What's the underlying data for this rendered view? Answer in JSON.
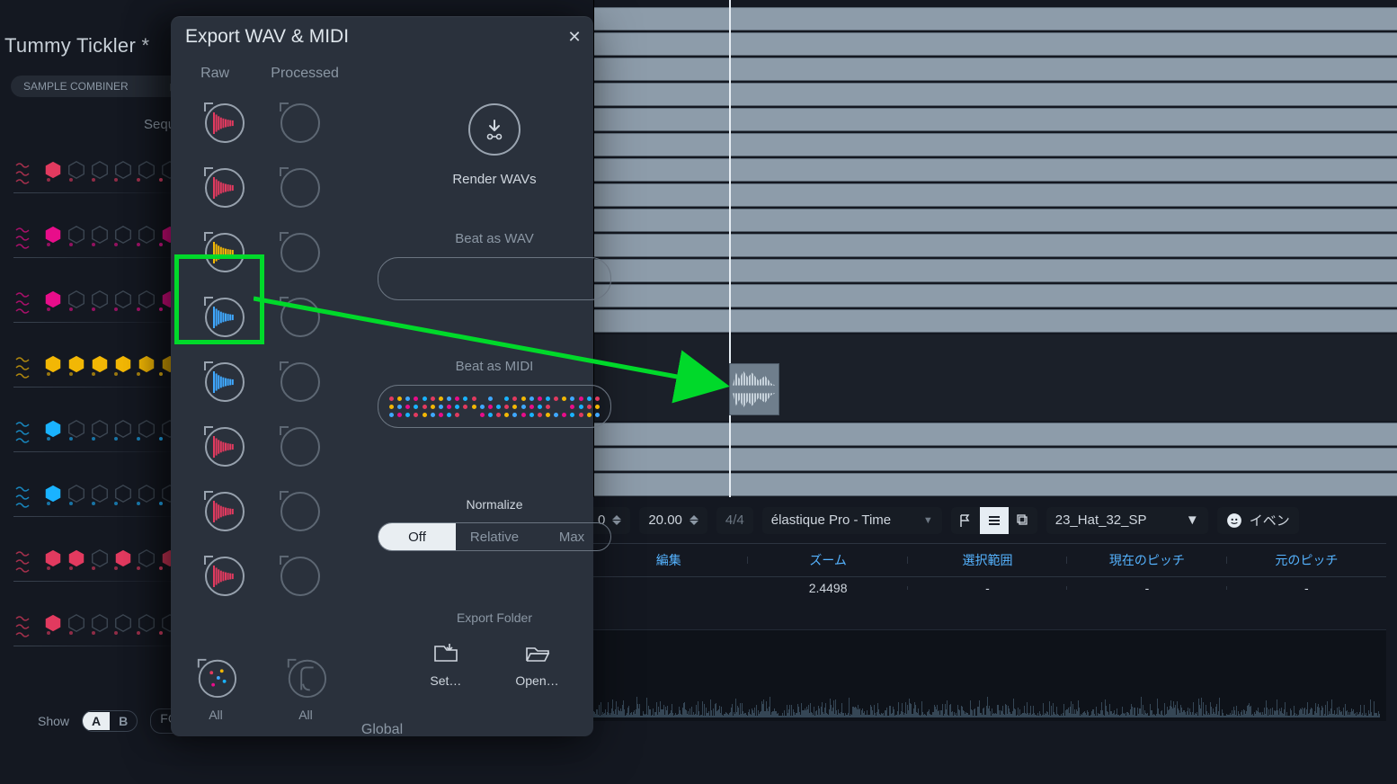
{
  "project": {
    "title": "Tummy Tickler *"
  },
  "combiner": {
    "label": "SAMPLE COMBINER"
  },
  "sequencer": {
    "header": "Sequ",
    "rows": [
      {
        "color": "#e23a5f",
        "pattern": [
          1,
          0,
          0,
          0,
          0,
          0
        ]
      },
      {
        "color": "#e80d8a",
        "pattern": [
          1,
          0,
          0,
          0,
          0,
          1
        ]
      },
      {
        "color": "#e80d8a",
        "pattern": [
          1,
          0,
          0,
          0,
          0,
          1
        ]
      },
      {
        "color": "#f2b705",
        "pattern": [
          1,
          1,
          1,
          1,
          1,
          1
        ]
      },
      {
        "color": "#1ab3ff",
        "pattern": [
          1,
          0,
          0,
          0,
          0,
          0
        ]
      },
      {
        "color": "#1ab3ff",
        "pattern": [
          1,
          0,
          0,
          0,
          0,
          0
        ]
      },
      {
        "color": "#e23a5f",
        "pattern": [
          1,
          1,
          0,
          1,
          0,
          1
        ]
      },
      {
        "color": "#e23a5f",
        "pattern": [
          1,
          0,
          0,
          0,
          0,
          0
        ]
      }
    ],
    "showLabel": "Show",
    "ab": {
      "a": "A",
      "b": "B",
      "active": "A"
    },
    "fol": "FOL"
  },
  "dialog": {
    "title": "Export WAV & MIDI",
    "columns": {
      "raw": "Raw",
      "processed": "Processed"
    },
    "slots": [
      {
        "color": "#e23a5f"
      },
      {
        "color": "#e23a5f"
      },
      {
        "color": "#f2b705",
        "selected": true
      },
      {
        "color": "#3fa8ff"
      },
      {
        "color": "#3fa8ff"
      },
      {
        "color": "#e23a5f"
      },
      {
        "color": "#e23a5f"
      },
      {
        "color": "#e23a5f"
      }
    ],
    "all": "All",
    "render": "Render WAVs",
    "beatWav": "Beat as WAV",
    "beatMidi": "Beat as MIDI",
    "normalize": {
      "label": "Normalize",
      "options": [
        "Off",
        "Relative",
        "Max"
      ],
      "active": "Off"
    },
    "exportFolder": {
      "label": "Export Folder",
      "set": "Set…",
      "open": "Open…"
    },
    "global": "Global"
  },
  "transport": {
    "transpose": "0",
    "tempo": "20.00",
    "timesig": "4/4",
    "algorithm": "élastique Pro - Time",
    "source": "23_Hat_32_SP",
    "eventBtn": "イベン"
  },
  "info": {
    "headers": [
      "編集",
      "ズーム",
      "選択範囲",
      "現在のピッチ",
      "元のピッチ"
    ],
    "values": [
      "",
      "2.4498",
      "-",
      "-",
      "-"
    ]
  }
}
